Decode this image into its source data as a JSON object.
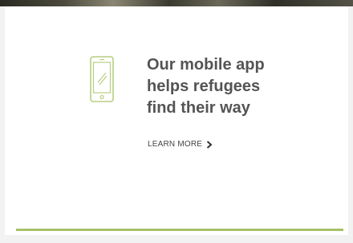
{
  "banner": {
    "headline": "Our mobile app\nhelps refugees\nfind their way",
    "cta_label": "LEARN MORE",
    "icon": "smartphone-icon",
    "cta_icon": "chevron-right-icon"
  },
  "colors": {
    "accent": "#a6c266",
    "headline_text": "#545454",
    "background": "#ffffff"
  }
}
